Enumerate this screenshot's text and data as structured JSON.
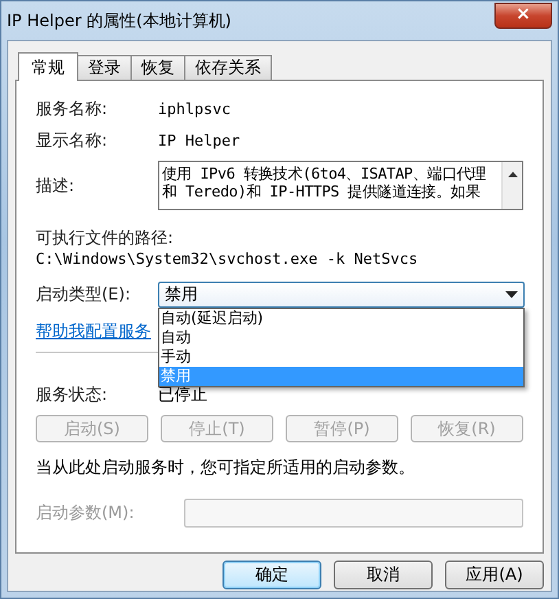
{
  "window": {
    "title": "IP Helper 的属性(本地计算机)",
    "close": "×"
  },
  "tabs": [
    {
      "label": "常规",
      "selected": true
    },
    {
      "label": "登录",
      "selected": false
    },
    {
      "label": "恢复",
      "selected": false
    },
    {
      "label": "依存关系",
      "selected": false
    }
  ],
  "fields": [
    {
      "label": "服务名称:",
      "value": "iphlpsvc"
    },
    {
      "label": "显示名称:",
      "value": "IP Helper"
    }
  ],
  "description": {
    "label": "描述:",
    "text": "使用 IPv6 转换技术(6to4、ISATAP、端口代理和 Teredo)和 IP-HTTPS 提供隧道连接。如果"
  },
  "path": {
    "label": "可执行文件的路径:",
    "value": "C:\\Windows\\System32\\svchost.exe -k NetSvcs"
  },
  "startup_type": {
    "label": "启动类型(E):",
    "value": "禁用",
    "expanded": true,
    "options": [
      {
        "label": "自动(延迟启动)",
        "selected": false
      },
      {
        "label": "自动",
        "selected": false
      },
      {
        "label": "手动",
        "selected": false
      },
      {
        "label": "禁用",
        "selected": true
      }
    ]
  },
  "help_link": "帮助我配置服务",
  "status": {
    "label": "服务状态:",
    "value": "已停止"
  },
  "service_buttons": [
    {
      "label": "启动(S)",
      "disabled": true
    },
    {
      "label": "停止(T)",
      "disabled": true
    },
    {
      "label": "暂停(P)",
      "disabled": true
    },
    {
      "label": "恢复(R)",
      "disabled": true
    }
  ],
  "hint": "当从此处启动服务时，您可指定所适用的启动参数。",
  "parameters": {
    "label": "启动参数(M):",
    "disabled": true
  },
  "dialog_buttons": [
    {
      "label": "确定",
      "default": true
    },
    {
      "label": "取消",
      "default": false
    },
    {
      "label": "应用(A)",
      "default": false
    }
  ]
}
